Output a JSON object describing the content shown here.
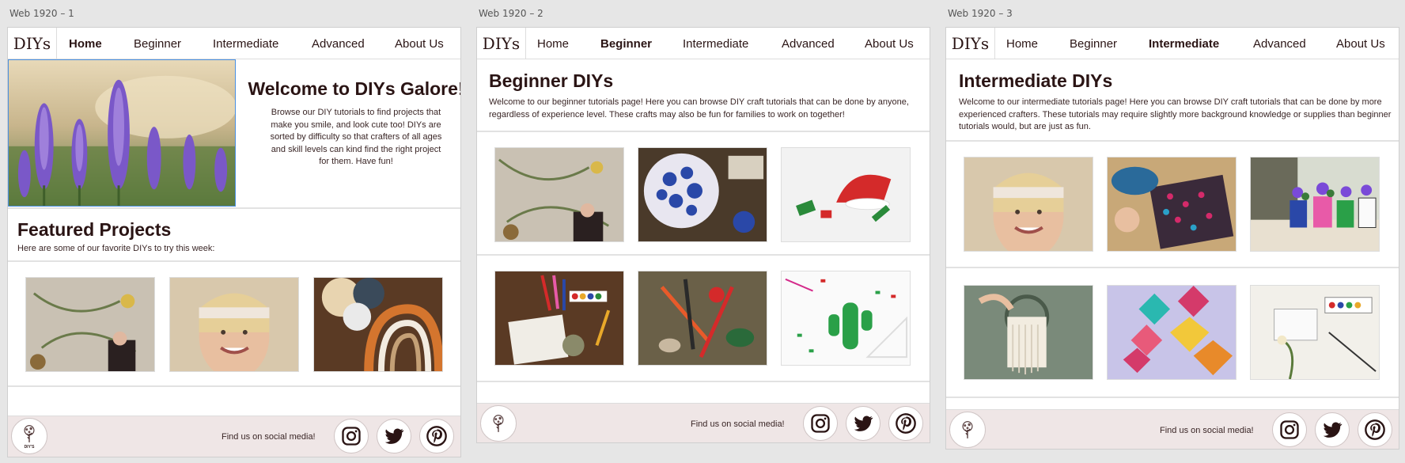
{
  "artboards": [
    "Web 1920 – 1",
    "Web 1920 – 2",
    "Web 1920 – 3"
  ],
  "nav": {
    "logo": "DIYs",
    "items": [
      "Home",
      "Beginner",
      "Intermediate",
      "Advanced",
      "About Us"
    ]
  },
  "home": {
    "active": "Home",
    "welcome_title": "Welcome to DIYs Galore!",
    "welcome_body": "Browse our DIY tutorials to find projects that make you smile, and look cute too! DIYs are sorted by difficulty so that crafters of all ages and skill levels can kind find the right project for them. Have fun!",
    "featured_title": "Featured Projects",
    "featured_sub": "Here are some of our favorite DIYs to try this week:"
  },
  "beginner": {
    "active": "Beginner",
    "title": "Beginner DIYs",
    "body": "Welcome to our beginner tutorials page! Here you can browse DIY craft tutorials that can be done by anyone, regardless of experience level. These crafts may also be fun for families to work on together!"
  },
  "intermediate": {
    "active": "Intermediate",
    "title": "Intermediate DIYs",
    "body": "Welcome to our intermediate tutorials page! Here you can browse DIY craft tutorials that can be done by more experienced crafters. These tutorials may require slightly more background knowledge or supplies than beginner tutorials would, but are just as fun."
  },
  "footer": {
    "text": "Find us on social media!",
    "logo_text": "DIY'S",
    "social": [
      "instagram-icon",
      "twitter-icon",
      "pinterest-icon"
    ]
  },
  "colors": {
    "text": "#2a1414",
    "footer_bg": "#efe6e6",
    "accent": "#4a90e2"
  }
}
